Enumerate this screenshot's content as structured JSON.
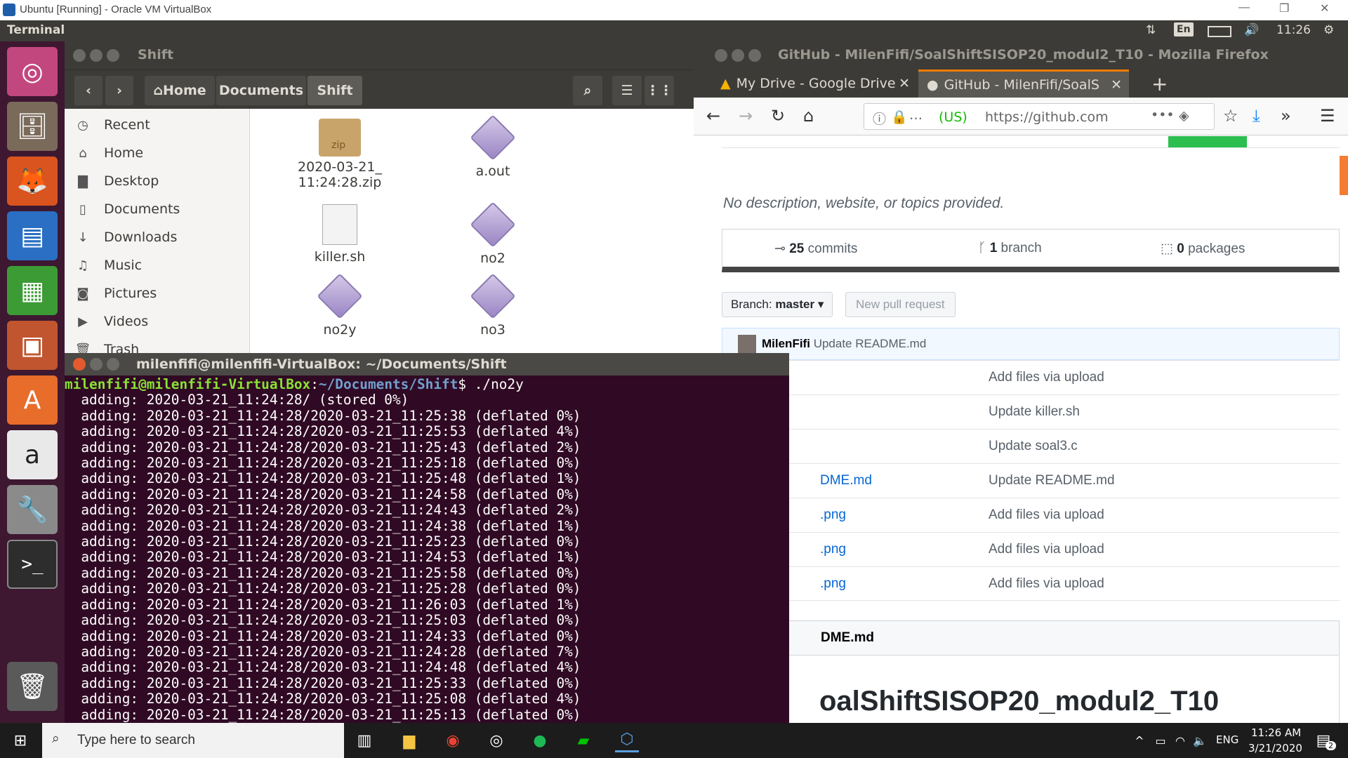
{
  "vbox": {
    "title": "Ubuntu [Running] - Oracle VM VirtualBox",
    "min": "—",
    "restore": "❐",
    "close": "✕"
  },
  "panel": {
    "app_name": "Terminal",
    "lang": "En",
    "time": "11:26"
  },
  "launcher": {
    "items": [
      "ubuntu-dash",
      "files",
      "firefox",
      "writer",
      "calc",
      "impress",
      "software-center",
      "amazon",
      "system-settings",
      "terminal",
      "trash"
    ]
  },
  "files": {
    "title": "Shift",
    "breadcrumb": {
      "home": "Home",
      "documents": "Documents",
      "shift": "Shift"
    },
    "sidebar": [
      "Recent",
      "Home",
      "Desktop",
      "Documents",
      "Downloads",
      "Music",
      "Pictures",
      "Videos",
      "Trash"
    ],
    "items": [
      {
        "name": "2020-03-21_\n11:24:28.zip",
        "type": "zip",
        "badge": "zip"
      },
      {
        "name": "a.out",
        "type": "exec"
      },
      {
        "name": "killer.sh",
        "type": "script"
      },
      {
        "name": "no2",
        "type": "exec"
      },
      {
        "name": "no2y",
        "type": "exec"
      },
      {
        "name": "no3",
        "type": "exec"
      }
    ]
  },
  "terminal": {
    "title": "milenfifi@milenfifi-VirtualBox: ~/Documents/Shift",
    "prompt_user": "milenfifi@milenfifi-VirtualBox",
    "prompt_colon": ":",
    "prompt_path": "~/Documents/Shift",
    "prompt_cmd": "$ ./no2y",
    "lines": [
      "  adding: 2020-03-21_11:24:28/ (stored 0%)",
      "  adding: 2020-03-21_11:24:28/2020-03-21_11:25:38 (deflated 0%)",
      "  adding: 2020-03-21_11:24:28/2020-03-21_11:25:53 (deflated 4%)",
      "  adding: 2020-03-21_11:24:28/2020-03-21_11:25:43 (deflated 2%)",
      "  adding: 2020-03-21_11:24:28/2020-03-21_11:25:18 (deflated 0%)",
      "  adding: 2020-03-21_11:24:28/2020-03-21_11:25:48 (deflated 1%)",
      "  adding: 2020-03-21_11:24:28/2020-03-21_11:24:58 (deflated 0%)",
      "  adding: 2020-03-21_11:24:28/2020-03-21_11:24:43 (deflated 2%)",
      "  adding: 2020-03-21_11:24:28/2020-03-21_11:24:38 (deflated 1%)",
      "  adding: 2020-03-21_11:24:28/2020-03-21_11:25:23 (deflated 0%)",
      "  adding: 2020-03-21_11:24:28/2020-03-21_11:24:53 (deflated 1%)",
      "  adding: 2020-03-21_11:24:28/2020-03-21_11:25:58 (deflated 0%)",
      "  adding: 2020-03-21_11:24:28/2020-03-21_11:25:28 (deflated 0%)",
      "  adding: 2020-03-21_11:24:28/2020-03-21_11:26:03 (deflated 1%)",
      "  adding: 2020-03-21_11:24:28/2020-03-21_11:25:03 (deflated 0%)",
      "  adding: 2020-03-21_11:24:28/2020-03-21_11:24:33 (deflated 0%)",
      "  adding: 2020-03-21_11:24:28/2020-03-21_11:24:28 (deflated 7%)",
      "  adding: 2020-03-21_11:24:28/2020-03-21_11:24:48 (deflated 4%)",
      "  adding: 2020-03-21_11:24:28/2020-03-21_11:25:33 (deflated 0%)",
      "  adding: 2020-03-21_11:24:28/2020-03-21_11:25:08 (deflated 4%)",
      "  adding: 2020-03-21_11:24:28/2020-03-21_11:25:13 (deflated 0%)"
    ]
  },
  "firefox": {
    "title": "GitHub - MilenFifi/SoalShiftSISOP20_modul2_T10 - Mozilla Firefox",
    "tabs": [
      {
        "label": "My Drive - Google Drive"
      },
      {
        "label": "GitHub - MilenFifi/SoalS"
      }
    ],
    "url_cert": "(US)",
    "url": "https://github.com",
    "github": {
      "description": "No description, website, or topics provided.",
      "commits": "25",
      "commits_label": "commits",
      "branches": "1",
      "branches_label": "branch",
      "packages": "0",
      "packages_label": "packages",
      "branch_btn": "Branch:",
      "branch_name": "master",
      "new_pr": "New pull request",
      "last_commit_user": "MilenFifi",
      "last_commit_msg": "Update README.md",
      "files": [
        {
          "name": "",
          "msg": "Add files via upload"
        },
        {
          "name": "",
          "msg": "Update killer.sh"
        },
        {
          "name": "",
          "msg": "Update soal3.c"
        },
        {
          "name": "DME.md",
          "msg": "Update README.md"
        },
        {
          "name": ".png",
          "msg": "Add files via upload"
        },
        {
          "name": ".png",
          "msg": "Add files via upload"
        },
        {
          "name": ".png",
          "msg": "Add files via upload"
        }
      ],
      "readme_header": "DME.md",
      "readme_title": "oalShiftSISOP20_modul2_T10"
    }
  },
  "taskbar": {
    "search_placeholder": "Type here to search",
    "lang": "ENG",
    "time": "11:26 AM",
    "date": "3/21/2020",
    "notif": "2"
  }
}
